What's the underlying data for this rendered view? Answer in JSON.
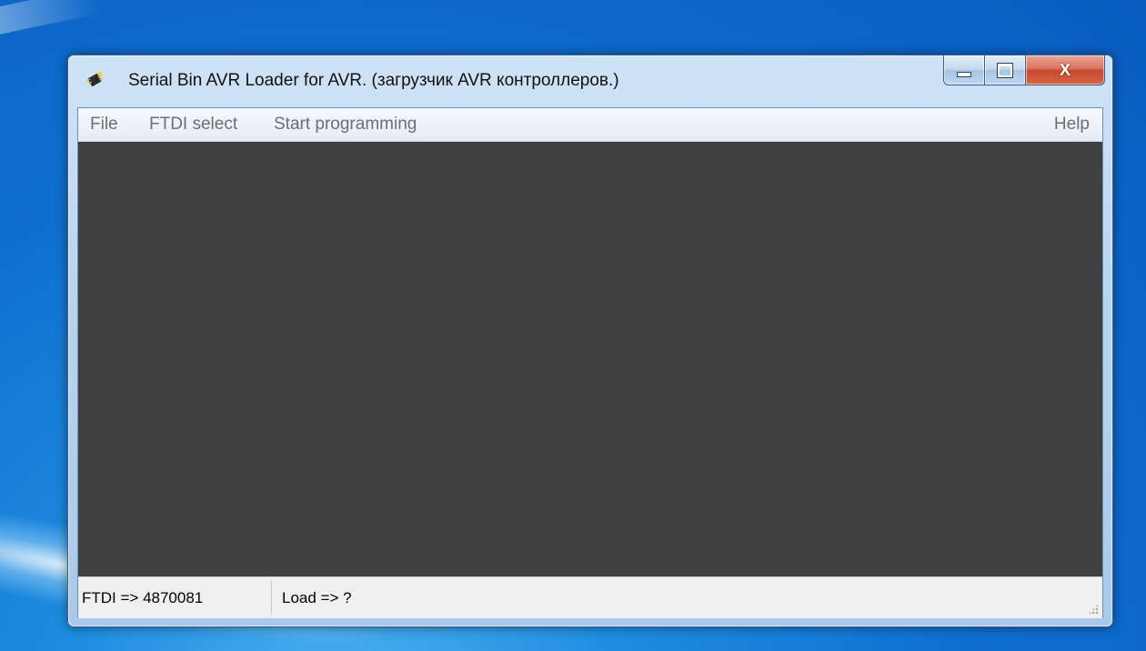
{
  "window": {
    "title": "Serial Bin AVR Loader for AVR. (загрузчик AVR контроллеров.)",
    "icon": "app-chip-icon"
  },
  "caption_buttons": {
    "minimize_icon": "minimize-icon",
    "maximize_icon": "maximize-icon",
    "close_label": "X"
  },
  "menu": {
    "items": [
      {
        "label": "File"
      },
      {
        "label": "FTDI select"
      },
      {
        "label": "Start programming"
      }
    ],
    "help": "Help"
  },
  "canvas": {
    "background": "#404040"
  },
  "status": {
    "ftdi": "FTDI => 4870081",
    "load": "Load => ?"
  }
}
